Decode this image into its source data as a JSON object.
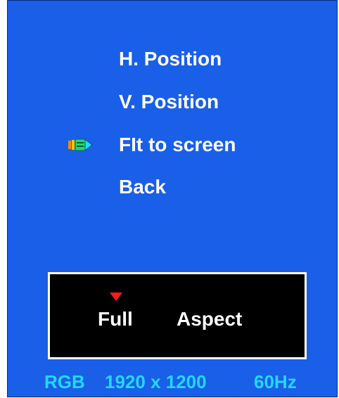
{
  "menu": {
    "items": [
      {
        "label": "H. Position"
      },
      {
        "label": "V. Position"
      },
      {
        "label": "FIt to screen",
        "selected": true
      },
      {
        "label": "Back"
      }
    ],
    "selector_icon": "selector-arrow-icon"
  },
  "mode": {
    "options": [
      {
        "label": "Full",
        "selected": true
      },
      {
        "label": "Aspect"
      }
    ],
    "indicator_icon": "triangle-down-icon"
  },
  "status": {
    "signal": "RGB",
    "resolution": "1920 x 1200",
    "frequency": "60Hz"
  },
  "colors": {
    "background": "#1a5fe8",
    "text": "#ffffff",
    "status_text": "#22d8ff",
    "indicator": "#ff1a1a",
    "mode_box": "#000000"
  }
}
